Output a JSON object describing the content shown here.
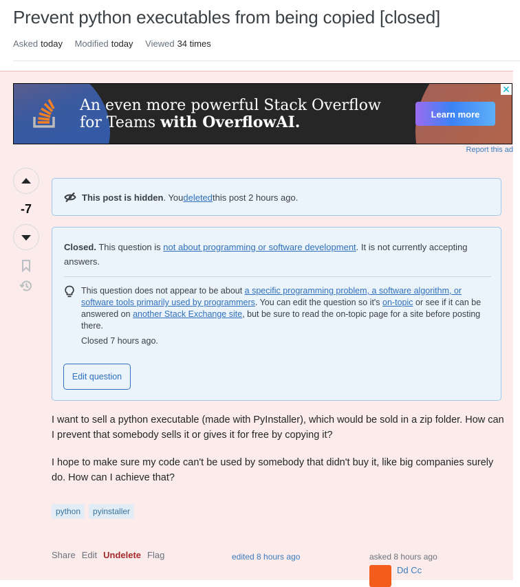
{
  "question": {
    "title": "Prevent python executables from being copied [closed]",
    "meta": [
      {
        "label": "Asked",
        "value": "today"
      },
      {
        "label": "Modified",
        "value": "today"
      },
      {
        "label": "Viewed",
        "value": "34 times"
      }
    ],
    "score": "-7",
    "body": [
      "I want to sell a python executable (made with PyInstaller), which would be sold in a zip folder. How can I prevent that somebody sells it or gives it for free by copying it?",
      "I hope to make sure my code can't be used by somebody that didn't buy it, like big companies surely do. How can I achieve that?"
    ],
    "tags": [
      "python",
      "pyinstaller"
    ],
    "actions": {
      "share": "Share",
      "edit": "Edit",
      "undelete": "Undelete",
      "flag": "Flag"
    },
    "edited": "edited 8 hours ago",
    "asked": "asked 8 hours ago",
    "user": "Dd Cc"
  },
  "ad": {
    "line1": "An even more powerful Stack Overflow",
    "line2_plain": "for Teams ",
    "line2_bold": "with OverflowAI.",
    "cta": "Learn more",
    "close": "✕",
    "report": "Report this ad"
  },
  "hidden_notice": {
    "bold": "This post is hidden",
    "text1": ". You ",
    "link": "deleted",
    "text2": " this post 2 hours ago."
  },
  "closed_notice": {
    "bold": "Closed.",
    "text1": " This question is ",
    "link1": "not about programming or software development",
    "text2": ". It is not currently accepting answers.",
    "reason_text1": "This question does not appear to be about ",
    "reason_link1": "a specific programming problem, a software algorithm, or software tools primarily used by programmers",
    "reason_text2": ". You can edit the question so it's ",
    "reason_link2": "on-topic",
    "reason_text3": " or see if it can be answered on ",
    "reason_link3": "another Stack Exchange site",
    "reason_text4": ", but be sure to read the on-topic page for a site before posting there.",
    "closed_time": "Closed 7 hours ago.",
    "edit_button": "Edit question"
  }
}
